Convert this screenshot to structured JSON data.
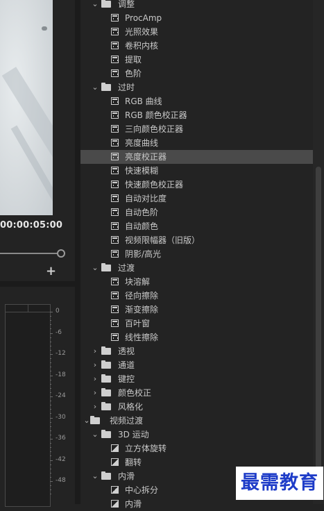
{
  "monitor": {
    "timecode": "00:00:05:00",
    "add_button": "+",
    "meter_scale": [
      "0",
      "-6",
      "-12",
      "-18",
      "-24",
      "-30",
      "-36",
      "-42",
      "-48"
    ]
  },
  "effects_tree": [
    {
      "kind": "folder",
      "label": "调整",
      "expanded": true,
      "level": 1
    },
    {
      "kind": "effect",
      "label": "ProcAmp",
      "level": 2
    },
    {
      "kind": "effect",
      "label": "光照效果",
      "level": 2
    },
    {
      "kind": "effect",
      "label": "卷积内核",
      "level": 2
    },
    {
      "kind": "effect",
      "label": "提取",
      "level": 2
    },
    {
      "kind": "effect",
      "label": "色阶",
      "level": 2
    },
    {
      "kind": "folder",
      "label": "过时",
      "expanded": true,
      "level": 1
    },
    {
      "kind": "effect",
      "label": "RGB 曲线",
      "level": 2
    },
    {
      "kind": "effect",
      "label": "RGB 颜色校正器",
      "level": 2
    },
    {
      "kind": "effect",
      "label": "三向颜色校正器",
      "level": 2
    },
    {
      "kind": "effect",
      "label": "亮度曲线",
      "level": 2
    },
    {
      "kind": "effect",
      "label": "亮度校正器",
      "level": 2,
      "selected": true
    },
    {
      "kind": "effect",
      "label": "快速模糊",
      "level": 2
    },
    {
      "kind": "effect",
      "label": "快速颜色校正器",
      "level": 2
    },
    {
      "kind": "effect",
      "label": "自动对比度",
      "level": 2
    },
    {
      "kind": "effect",
      "label": "自动色阶",
      "level": 2
    },
    {
      "kind": "effect",
      "label": "自动颜色",
      "level": 2
    },
    {
      "kind": "effect",
      "label": "视频限幅器（旧版）",
      "level": 2
    },
    {
      "kind": "effect",
      "label": "阴影/高光",
      "level": 2
    },
    {
      "kind": "folder",
      "label": "过渡",
      "expanded": true,
      "level": 1
    },
    {
      "kind": "effect",
      "label": "块溶解",
      "level": 2
    },
    {
      "kind": "effect",
      "label": "径向擦除",
      "level": 2
    },
    {
      "kind": "effect",
      "label": "渐变擦除",
      "level": 2
    },
    {
      "kind": "effect",
      "label": "百叶窗",
      "level": 2
    },
    {
      "kind": "effect",
      "label": "线性擦除",
      "level": 2
    },
    {
      "kind": "folder",
      "label": "透视",
      "expanded": false,
      "level": 1
    },
    {
      "kind": "folder",
      "label": "通道",
      "expanded": false,
      "level": 1
    },
    {
      "kind": "folder",
      "label": "键控",
      "expanded": false,
      "level": 1
    },
    {
      "kind": "folder",
      "label": "颜色校正",
      "expanded": false,
      "level": 1
    },
    {
      "kind": "folder",
      "label": "风格化",
      "expanded": false,
      "level": 1
    },
    {
      "kind": "folder",
      "label": "视频过渡",
      "expanded": true,
      "level": 0
    },
    {
      "kind": "folder",
      "label": "3D 运动",
      "expanded": true,
      "level": 1
    },
    {
      "kind": "transition",
      "label": "立方体旋转",
      "level": 2
    },
    {
      "kind": "transition",
      "label": "翻转",
      "level": 2
    },
    {
      "kind": "folder",
      "label": "内滑",
      "expanded": true,
      "level": 1
    },
    {
      "kind": "transition",
      "label": "中心拆分",
      "level": 2
    },
    {
      "kind": "transition",
      "label": "内滑",
      "level": 2
    }
  ],
  "watermark": "最需教育"
}
